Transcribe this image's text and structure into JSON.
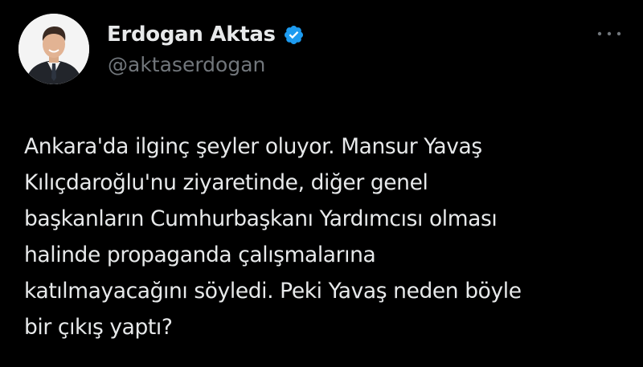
{
  "author": {
    "display_name": "Erdogan Aktas",
    "handle": "@aktaserdogan",
    "verified": true,
    "avatar_icon": "profile-photo-man-in-suit"
  },
  "icons": {
    "verified": "verified-badge-icon",
    "more": "more-options-icon"
  },
  "colors": {
    "background": "#000000",
    "text_primary": "#e7e9ea",
    "text_secondary": "#71767b",
    "verified_blue": "#1d9bf0"
  },
  "tweet": {
    "lines": [
      "Ankara'da ilginç şeyler oluyor. Mansur Yavaş",
      "Kılıçdaroğlu'nu ziyaretinde, diğer genel",
      "başkanların Cumhurbaşkanı Yardımcısı olması",
      "halinde propaganda çalışmalarına",
      "katılmayacağını söyledi. Peki Yavaş neden böyle",
      "bir çıkış yaptı?"
    ]
  }
}
